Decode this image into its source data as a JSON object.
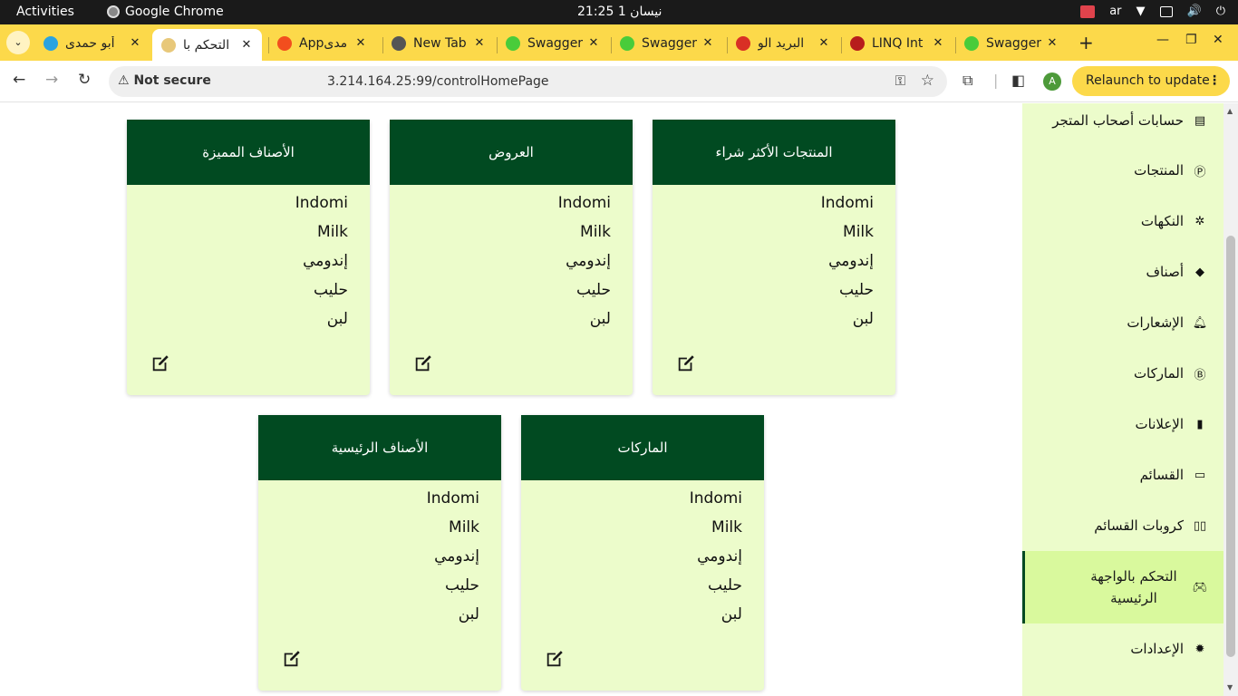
{
  "os": {
    "activities": "Activities",
    "app_name": "Google Chrome",
    "clock": "نيسان 1  21:25",
    "lang": "ar"
  },
  "tabs": [
    {
      "title": "أبو حمدى",
      "icon": "telegram-icon",
      "color": "#2aa3e0"
    },
    {
      "title": "التحكم با",
      "icon": "app-logo-icon",
      "color": "#e8c87a"
    },
    {
      "title": "Appمدى",
      "icon": "figma-icon",
      "color": "#f24e1e"
    },
    {
      "title": "New Tab",
      "icon": "chrome-icon",
      "color": "#555"
    },
    {
      "title": "Swagger",
      "icon": "swagger-icon",
      "color": "#49cc3a"
    },
    {
      "title": "Swagger",
      "icon": "swagger-icon",
      "color": "#49cc3a"
    },
    {
      "title": "البريد الو",
      "icon": "gmail-icon",
      "color": "#d93025"
    },
    {
      "title": "LINQ Int",
      "icon": "linq-icon",
      "color": "#b71c1c"
    },
    {
      "title": "Swagger",
      "icon": "swagger-icon",
      "color": "#49cc3a"
    }
  ],
  "toolbar": {
    "security": "Not secure",
    "url": "3.214.164.25:99/controlHomePage",
    "avatar": "A",
    "relaunch": "Relaunch to update"
  },
  "cards": [
    {
      "title": "المنتجات الأكثر شراء",
      "items": [
        "Indomi",
        "Milk",
        "إندومي",
        "حليب",
        "لبن"
      ]
    },
    {
      "title": "العروض",
      "items": [
        "Indomi",
        "Milk",
        "إندومي",
        "حليب",
        "لبن"
      ]
    },
    {
      "title": "الأصناف المميزة",
      "items": [
        "Indomi",
        "Milk",
        "إندومي",
        "حليب",
        "لبن"
      ]
    },
    {
      "title": "الماركات",
      "items": [
        "Indomi",
        "Milk",
        "إندومي",
        "حليب",
        "لبن"
      ]
    },
    {
      "title": "الأصناف الرئيسية",
      "items": [
        "Indomi",
        "Milk",
        "إندومي",
        "حليب",
        "لبن"
      ]
    }
  ],
  "sidebar": {
    "items": [
      {
        "label": "حسابات أصحاب المتجر",
        "icon": "store-icon"
      },
      {
        "label": "المنتجات",
        "icon": "product-icon"
      },
      {
        "label": "النكهات",
        "icon": "flavor-icon"
      },
      {
        "label": "أصناف",
        "icon": "shapes-icon"
      },
      {
        "label": "الإشعارات",
        "icon": "bell-icon"
      },
      {
        "label": "الماركات",
        "icon": "brand-icon"
      },
      {
        "label": "الإعلانات",
        "icon": "ads-icon"
      },
      {
        "label": "القسائم",
        "icon": "ticket-icon"
      },
      {
        "label": "كروبات القسائم",
        "icon": "coupon-groups-icon"
      },
      {
        "label": "التحكم بالواجهة الرئيسية",
        "icon": "gamepad-icon",
        "active": true
      },
      {
        "label": "الإعدادات",
        "icon": "settings-icon"
      }
    ]
  },
  "colors": {
    "accent": "#014a21",
    "card_bg": "#ecfccb",
    "active_item": "#d9f99d",
    "tabbar": "#fcd94a"
  }
}
